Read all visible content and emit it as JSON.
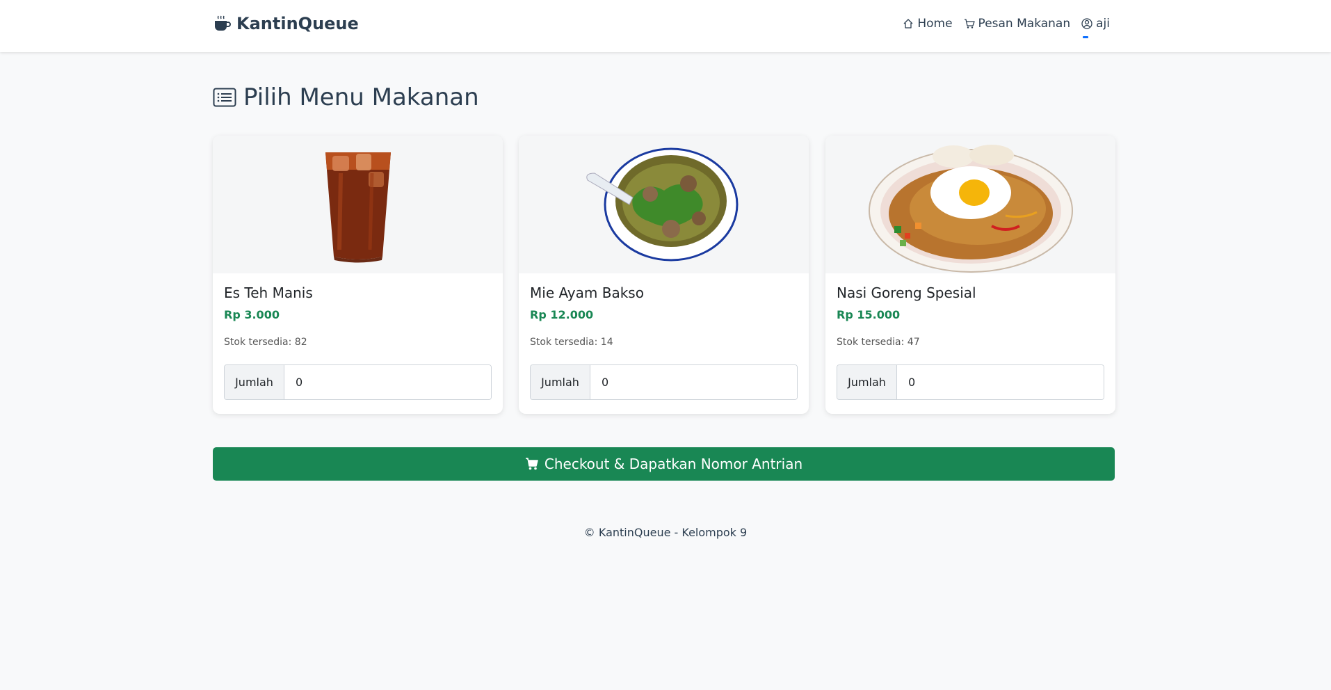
{
  "navbar": {
    "brand": "KantinQueue",
    "links": [
      {
        "label": "Home",
        "icon": "house-icon"
      },
      {
        "label": "Pesan Makanan",
        "icon": "cart-icon"
      },
      {
        "label": "aji",
        "icon": "user-circle-icon"
      }
    ]
  },
  "page": {
    "title": "Pilih Menu Makanan",
    "title_icon": "list-icon"
  },
  "menu": [
    {
      "name": "Es Teh Manis",
      "price": "Rp 3.000",
      "stock": "Stok tersedia: 82",
      "qty_label": "Jumlah",
      "qty_value": "0",
      "image": "iced-tea-image"
    },
    {
      "name": "Mie Ayam Bakso",
      "price": "Rp 12.000",
      "stock": "Stok tersedia: 14",
      "qty_label": "Jumlah",
      "qty_value": "0",
      "image": "noodle-soup-image"
    },
    {
      "name": "Nasi Goreng Spesial",
      "price": "Rp 15.000",
      "stock": "Stok tersedia: 47",
      "qty_label": "Jumlah",
      "qty_value": "0",
      "image": "fried-rice-image"
    }
  ],
  "checkout": {
    "label": "Checkout & Dapatkan Nomor Antrian",
    "icon": "cart-fill-icon"
  },
  "footer": {
    "text": "© KantinQueue - Kelompok 9"
  },
  "colors": {
    "accent_green": "#198754",
    "navy": "#2c3e50",
    "active_blue": "#0d6efd",
    "background": "#f8f9fa"
  }
}
